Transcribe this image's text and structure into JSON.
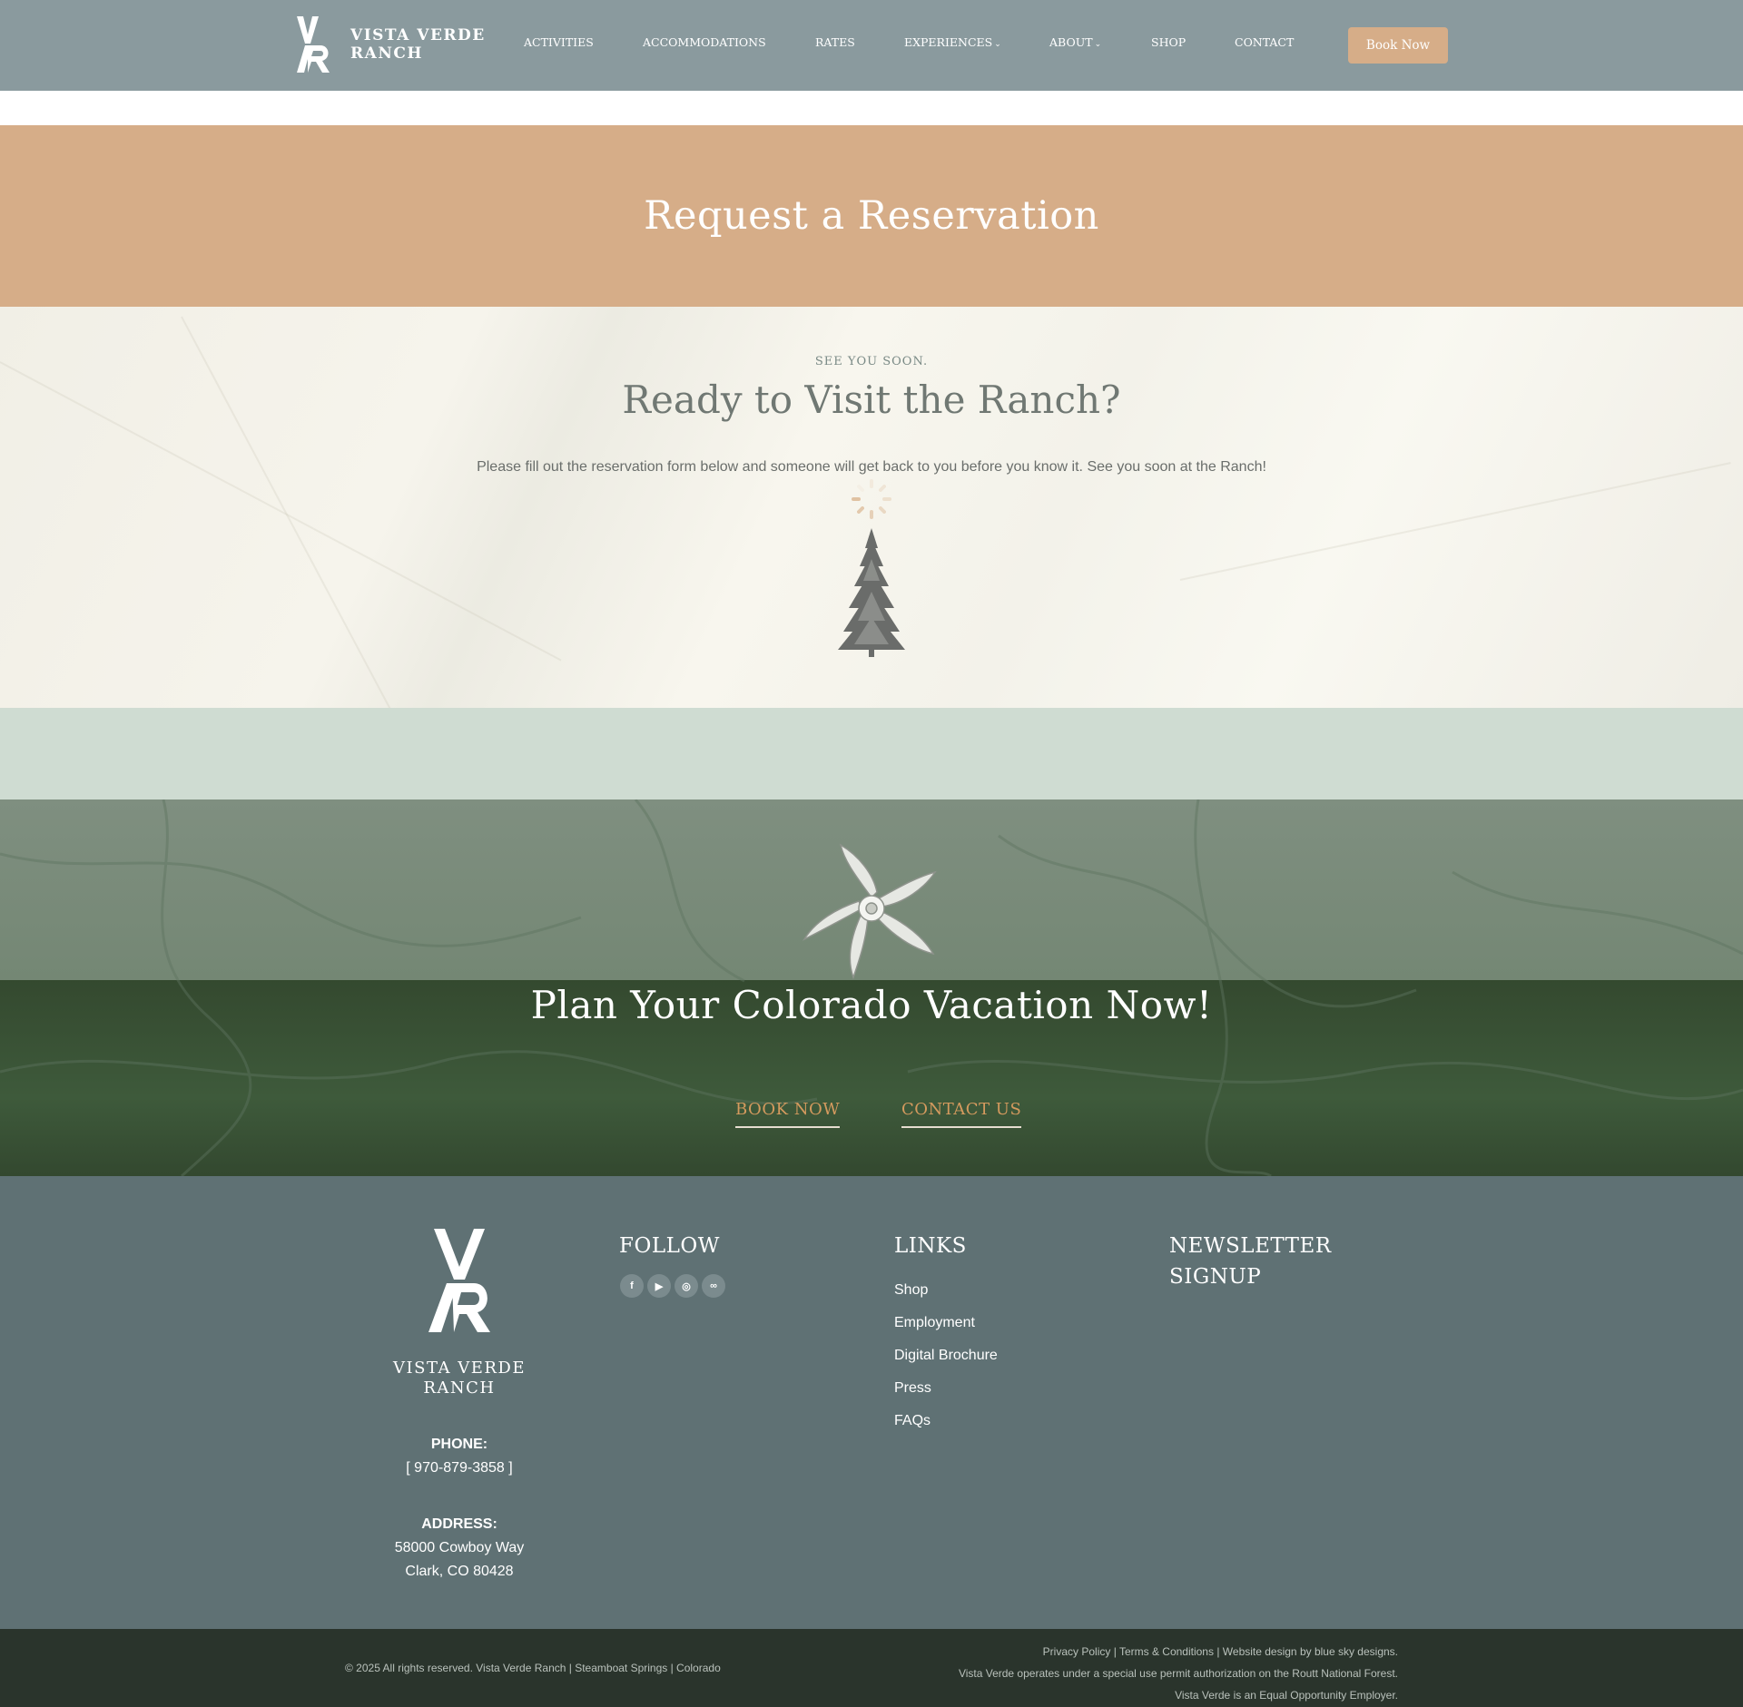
{
  "header": {
    "brand": "VISTA VERDE RANCH",
    "brand_line1": "VISTA VERDE",
    "brand_line2": "RANCH",
    "logo_letters": "VR",
    "nav": [
      {
        "label": "ACTIVITIES"
      },
      {
        "label": "ACCOMMODATIONS"
      },
      {
        "label": "RATES"
      },
      {
        "label": "EXPERIENCES",
        "dropdown": true
      },
      {
        "label": "ABOUT",
        "dropdown": true
      },
      {
        "label": "SHOP"
      },
      {
        "label": "CONTACT"
      }
    ],
    "book_button": "Book Now"
  },
  "title_band": {
    "title": "Request a Reservation"
  },
  "intro": {
    "eyebrow": "SEE YOU SOON.",
    "heading": "Ready to Visit the Ranch?",
    "text": "Please fill out the reservation form below and someone will get back to you before you know it. See you soon at the Ranch!"
  },
  "cta": {
    "heading": "Plan Your Colorado Vacation Now!",
    "book_link": "BOOK NOW",
    "contact_link": "CONTACT US"
  },
  "footer": {
    "logo_line1": "VISTA VERDE",
    "logo_line2": "RANCH",
    "phone_label": "PHONE:",
    "phone_value": "[ 970-879-3858 ]",
    "address_label": "ADDRESS:",
    "address_line1": "58000 Cowboy Way",
    "address_line2": "Clark, CO 80428",
    "follow_heading": "FOLLOW",
    "social": [
      {
        "icon": "facebook-icon",
        "glyph": "f"
      },
      {
        "icon": "youtube-icon",
        "glyph": "▶"
      },
      {
        "icon": "instagram-icon",
        "glyph": "◎"
      },
      {
        "icon": "tripadvisor-icon",
        "glyph": "∞"
      }
    ],
    "links_heading": "LINKS",
    "links": [
      "Shop",
      "Employment",
      "Digital Brochure",
      "Press",
      "FAQs"
    ],
    "newsletter_line1": "NEWSLETTER",
    "newsletter_line2": "SIGNUP"
  },
  "bottom_bar": {
    "copyright": "© 2025 All rights reserved. Vista Verde Ranch | Steamboat Springs | Colorado",
    "privacy": "Privacy Policy",
    "terms": "Terms & Conditions",
    "design_credit": "Website design by blue sky designs.",
    "permit": "Vista Verde operates under a special use permit authorization on the Routt National Forest.",
    "eeo": "Vista Verde is an Equal Opportunity Employer."
  },
  "colors": {
    "header_bg": "#8a9a9e",
    "accent_tan": "#d6ad88",
    "mint": "#cfdcd2",
    "forest": "#3f5640",
    "footer_bg": "#5f7174",
    "bottom_bg": "#2a342c",
    "link_orange": "#d49a5e"
  }
}
